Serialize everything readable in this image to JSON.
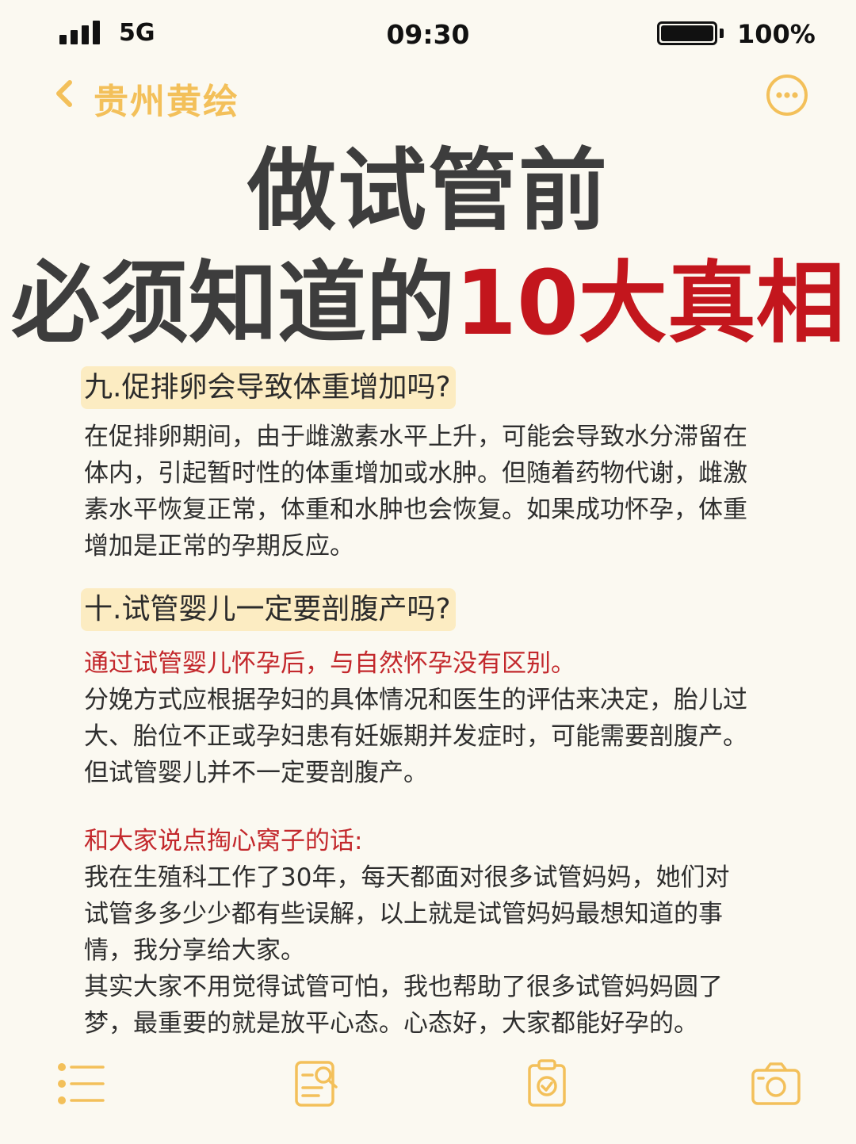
{
  "status": {
    "network": "5G",
    "time": "09:30",
    "battery": "100%"
  },
  "nav": {
    "title": "贵州黄绘"
  },
  "title": {
    "line1": "做试管前",
    "line2_plain": "必须知道的",
    "line2_accent": "10大真相"
  },
  "sections": [
    {
      "heading": "九.促排卵会导致体重增加吗?",
      "lines": [
        "在促排卵期间，由于雌激素水平上升，可能会导致水分滞留在",
        "体内，引起暂时性的体重增加或水肿。但随着药物代谢，雌激",
        "素水平恢复正常，体重和水肿也会恢复。如果成功怀孕，体重",
        "增加是正常的孕期反应。"
      ]
    },
    {
      "heading": "十.试管婴儿一定要剖腹产吗?",
      "lead": "通过试管婴儿怀孕后，与自然怀孕没有区别。",
      "lines": [
        "分娩方式应根据孕妇的具体情况和医生的评估来决定，胎儿过",
        "大、胎位不正或孕妇患有妊娠期并发症时，可能需要剖腹产。",
        "但试管婴儿并不一定要剖腹产。"
      ]
    }
  ],
  "closing": {
    "lead": "和大家说点掏心窝子的话:",
    "lines": [
      "我在生殖科工作了30年，每天都面对很多试管妈妈，她们对",
      "试管多多少少都有些误解，以上就是试管妈妈最想知道的事",
      "情，我分享给大家。",
      "其实大家不用觉得试管可怕，我也帮助了很多试管妈妈圆了",
      "梦，最重要的就是放平心态。心态好，大家都能好孕的。"
    ]
  },
  "colors": {
    "accent_red": "#c3161d",
    "nav_yellow": "#f3c05a",
    "heading_bg": "#fcecc2",
    "background": "#fbf9f1"
  },
  "icons": {
    "tabs": [
      "list-icon",
      "search-document-icon",
      "clipboard-check-icon",
      "camera-icon"
    ],
    "nav": [
      "back-chevron-icon",
      "more-icon"
    ]
  }
}
